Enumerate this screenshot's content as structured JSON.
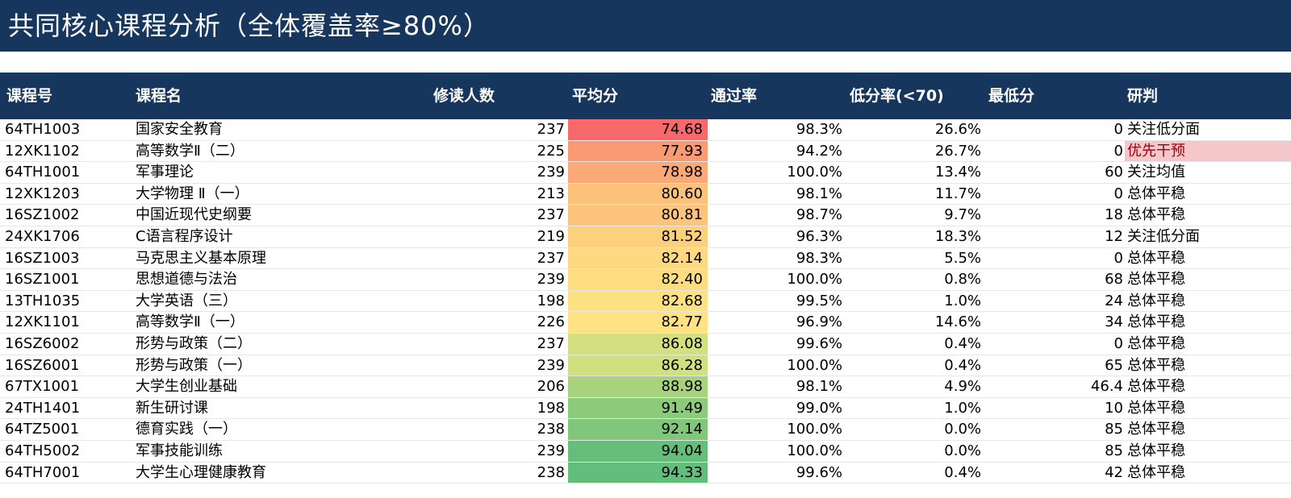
{
  "title": "共同核心课程分析（全体覆盖率≥80%）",
  "columns": {
    "code": "课程号",
    "name": "课程名",
    "enrolled": "修读人数",
    "avg": "平均分",
    "pass": "通过率",
    "low": "低分率(<70)",
    "min": "最低分",
    "judge": "研判"
  },
  "rows": [
    {
      "code": "64TH1003",
      "name": "国家安全教育",
      "enrolled": "237",
      "avg": "74.68",
      "pass": "98.3%",
      "low": "26.6%",
      "min": "0",
      "judge": "关注低分面",
      "avg_color": "#f8696b",
      "alert": false
    },
    {
      "code": "12XK1102",
      "name": "高等数学Ⅱ（二）",
      "enrolled": "225",
      "avg": "77.93",
      "pass": "94.2%",
      "low": "26.7%",
      "min": "0",
      "judge": "优先干预",
      "avg_color": "#fa9a73",
      "alert": true
    },
    {
      "code": "64TH1001",
      "name": "军事理论",
      "enrolled": "239",
      "avg": "78.98",
      "pass": "100.0%",
      "low": "13.4%",
      "min": "60",
      "judge": "关注均值",
      "avg_color": "#fba976",
      "alert": false
    },
    {
      "code": "12XK1203",
      "name": "大学物理 Ⅱ（一）",
      "enrolled": "213",
      "avg": "80.60",
      "pass": "98.1%",
      "low": "11.7%",
      "min": "0",
      "judge": "总体平稳",
      "avg_color": "#fcc27b",
      "alert": false
    },
    {
      "code": "16SZ1002",
      "name": "中国近现代史纲要",
      "enrolled": "237",
      "avg": "80.81",
      "pass": "98.7%",
      "low": "9.7%",
      "min": "18",
      "judge": "总体平稳",
      "avg_color": "#fcc47c",
      "alert": false
    },
    {
      "code": "24XK1706",
      "name": "C语言程序设计",
      "enrolled": "219",
      "avg": "81.52",
      "pass": "96.3%",
      "low": "18.3%",
      "min": "12",
      "judge": "关注低分面",
      "avg_color": "#fdd07e",
      "alert": false
    },
    {
      "code": "16SZ1003",
      "name": "马克思主义基本原理",
      "enrolled": "237",
      "avg": "82.14",
      "pass": "98.3%",
      "low": "5.5%",
      "min": "0",
      "judge": "总体平稳",
      "avg_color": "#fed981",
      "alert": false
    },
    {
      "code": "16SZ1001",
      "name": "思想道德与法治",
      "enrolled": "239",
      "avg": "82.40",
      "pass": "100.0%",
      "low": "0.8%",
      "min": "68",
      "judge": "总体平稳",
      "avg_color": "#fedd81",
      "alert": false
    },
    {
      "code": "13TH1035",
      "name": "大学英语（三）",
      "enrolled": "198",
      "avg": "82.68",
      "pass": "99.5%",
      "low": "1.0%",
      "min": "24",
      "judge": "总体平稳",
      "avg_color": "#fee282",
      "alert": false
    },
    {
      "code": "12XK1101",
      "name": "高等数学Ⅱ（一）",
      "enrolled": "226",
      "avg": "82.77",
      "pass": "96.9%",
      "low": "14.6%",
      "min": "34",
      "judge": "总体平稳",
      "avg_color": "#ffe383",
      "alert": false
    },
    {
      "code": "16SZ6002",
      "name": "形势与政策（二）",
      "enrolled": "237",
      "avg": "86.08",
      "pass": "99.6%",
      "low": "0.4%",
      "min": "0",
      "judge": "总体平稳",
      "avg_color": "#d4e07f",
      "alert": false
    },
    {
      "code": "16SZ6001",
      "name": "形势与政策（一）",
      "enrolled": "239",
      "avg": "86.28",
      "pass": "100.0%",
      "low": "0.4%",
      "min": "65",
      "judge": "总体平稳",
      "avg_color": "#d0df7f",
      "alert": false
    },
    {
      "code": "67TX1001",
      "name": "大学生创业基础",
      "enrolled": "206",
      "avg": "88.98",
      "pass": "98.1%",
      "low": "4.9%",
      "min": "46.4",
      "judge": "总体平稳",
      "avg_color": "#a9d27d",
      "alert": false
    },
    {
      "code": "24TH1401",
      "name": "新生研讨课",
      "enrolled": "198",
      "avg": "91.49",
      "pass": "99.0%",
      "low": "1.0%",
      "min": "10",
      "judge": "总体平稳",
      "avg_color": "#8ccb7c",
      "alert": false
    },
    {
      "code": "64TZ5001",
      "name": "德育实践（一）",
      "enrolled": "238",
      "avg": "92.14",
      "pass": "100.0%",
      "low": "0.0%",
      "min": "85",
      "judge": "总体平稳",
      "avg_color": "#80c77c",
      "alert": false
    },
    {
      "code": "64TH5002",
      "name": "军事技能训练",
      "enrolled": "239",
      "avg": "94.04",
      "pass": "100.0%",
      "low": "0.0%",
      "min": "85",
      "judge": "总体平稳",
      "avg_color": "#65bf7b",
      "alert": false
    },
    {
      "code": "64TH7001",
      "name": "大学生心理健康教育",
      "enrolled": "238",
      "avg": "94.33",
      "pass": "99.6%",
      "low": "0.4%",
      "min": "42",
      "judge": "总体平稳",
      "avg_color": "#63be7b",
      "alert": false
    }
  ]
}
